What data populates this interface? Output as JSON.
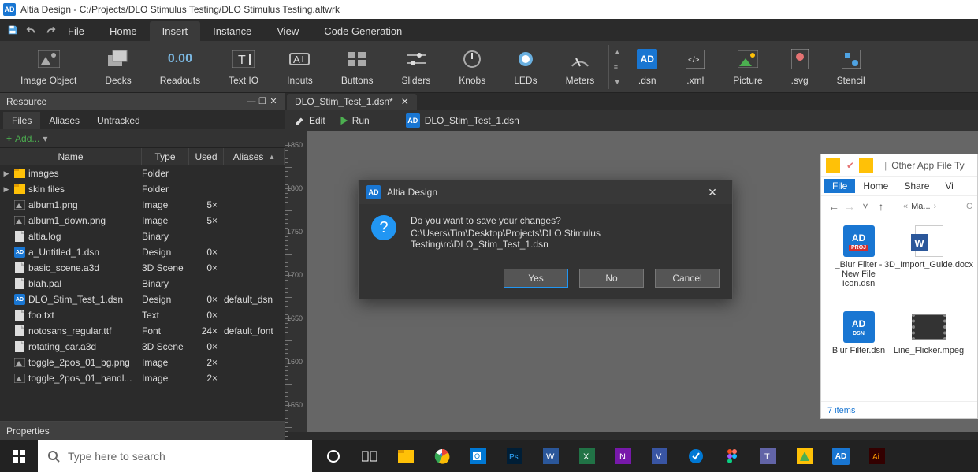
{
  "title_bar": "Altia Design - C:/Projects/DLO Stimulus Testing/DLO Stimulus Testing.altwrk",
  "menu": {
    "items": [
      "File",
      "Home",
      "Insert",
      "Instance",
      "View",
      "Code Generation"
    ],
    "active": "Insert"
  },
  "ribbon": {
    "items": [
      {
        "label": "Image Object"
      },
      {
        "label": "Decks"
      },
      {
        "label": "Readouts",
        "big": "0.00"
      },
      {
        "label": "Text IO"
      },
      {
        "label": "Inputs"
      },
      {
        "label": "Buttons"
      },
      {
        "label": "Sliders"
      },
      {
        "label": "Knobs"
      },
      {
        "label": "LEDs"
      },
      {
        "label": "Meters"
      }
    ],
    "right": [
      ".dsn",
      ".xml",
      "Picture",
      ".svg",
      "Stencil"
    ]
  },
  "resource": {
    "title": "Resource",
    "tabs": [
      "Files",
      "Aliases",
      "Untracked"
    ],
    "active_tab": "Files",
    "add": "Add...",
    "columns": [
      "Name",
      "Type",
      "Used",
      "Aliases"
    ],
    "rows": [
      {
        "expand": "▶",
        "icon": "folder",
        "name": "images",
        "type": "Folder",
        "used": "",
        "alias": ""
      },
      {
        "expand": "▶",
        "icon": "folder",
        "name": "skin files",
        "type": "Folder",
        "used": "",
        "alias": ""
      },
      {
        "expand": "",
        "icon": "img",
        "name": "album1.png",
        "type": "Image",
        "used": "5×",
        "alias": ""
      },
      {
        "expand": "",
        "icon": "img",
        "name": "album1_down.png",
        "type": "Image",
        "used": "5×",
        "alias": ""
      },
      {
        "expand": "",
        "icon": "file",
        "name": "altia.log",
        "type": "Binary",
        "used": "",
        "alias": ""
      },
      {
        "expand": "",
        "icon": "ad",
        "name": "a_Untitled_1.dsn",
        "type": "Design",
        "used": "0×",
        "alias": ""
      },
      {
        "expand": "",
        "icon": "file",
        "name": "basic_scene.a3d",
        "type": "3D Scene",
        "used": "0×",
        "alias": ""
      },
      {
        "expand": "",
        "icon": "file",
        "name": "blah.pal",
        "type": "Binary",
        "used": "",
        "alias": ""
      },
      {
        "expand": "",
        "icon": "ad",
        "name": "DLO_Stim_Test_1.dsn",
        "type": "Design",
        "used": "0×",
        "alias": "default_dsn"
      },
      {
        "expand": "",
        "icon": "file",
        "name": "foo.txt",
        "type": "Text",
        "used": "0×",
        "alias": ""
      },
      {
        "expand": "",
        "icon": "file",
        "name": "notosans_regular.ttf",
        "type": "Font",
        "used": "24×",
        "alias": "default_font"
      },
      {
        "expand": "",
        "icon": "file",
        "name": "rotating_car.a3d",
        "type": "3D Scene",
        "used": "0×",
        "alias": ""
      },
      {
        "expand": "",
        "icon": "img",
        "name": "toggle_2pos_01_bg.png",
        "type": "Image",
        "used": "2×",
        "alias": ""
      },
      {
        "expand": "",
        "icon": "img",
        "name": "toggle_2pos_01_handl...",
        "type": "Image",
        "used": "2×",
        "alias": ""
      }
    ]
  },
  "properties": {
    "title": "Properties"
  },
  "doc": {
    "tab": "DLO_Stim_Test_1.dsn*",
    "edit": "Edit",
    "run": "Run",
    "file": "DLO_Stim_Test_1.dsn"
  },
  "ruler_ticks": [
    "1850",
    "1800",
    "1750",
    "1700",
    "1650",
    "1600",
    "1550"
  ],
  "dialog": {
    "title": "Altia Design",
    "line1": "Do you want to save your changes?",
    "line2": "C:\\Users\\Tim\\Desktop\\Projects\\DLO Stimulus Testing\\rc\\DLO_Stim_Test_1.dsn",
    "yes": "Yes",
    "no": "No",
    "cancel": "Cancel"
  },
  "explorer": {
    "title_suffix": "Other App File Ty",
    "menu": [
      "File",
      "Home",
      "Share",
      "Vi"
    ],
    "crumb": "Ma...",
    "files": [
      {
        "icon": "ad-proj",
        "name": "_Blur Filter - New File Icon.dsn"
      },
      {
        "icon": "word",
        "name": "3D_Import_Guide.docx"
      },
      {
        "icon": "ad-dsn",
        "name": "Blur Filter.dsn"
      },
      {
        "icon": "mpeg",
        "name": "Line_Flicker.mpeg"
      }
    ],
    "status": "7 items"
  },
  "taskbar": {
    "search_placeholder": "Type here to search"
  }
}
